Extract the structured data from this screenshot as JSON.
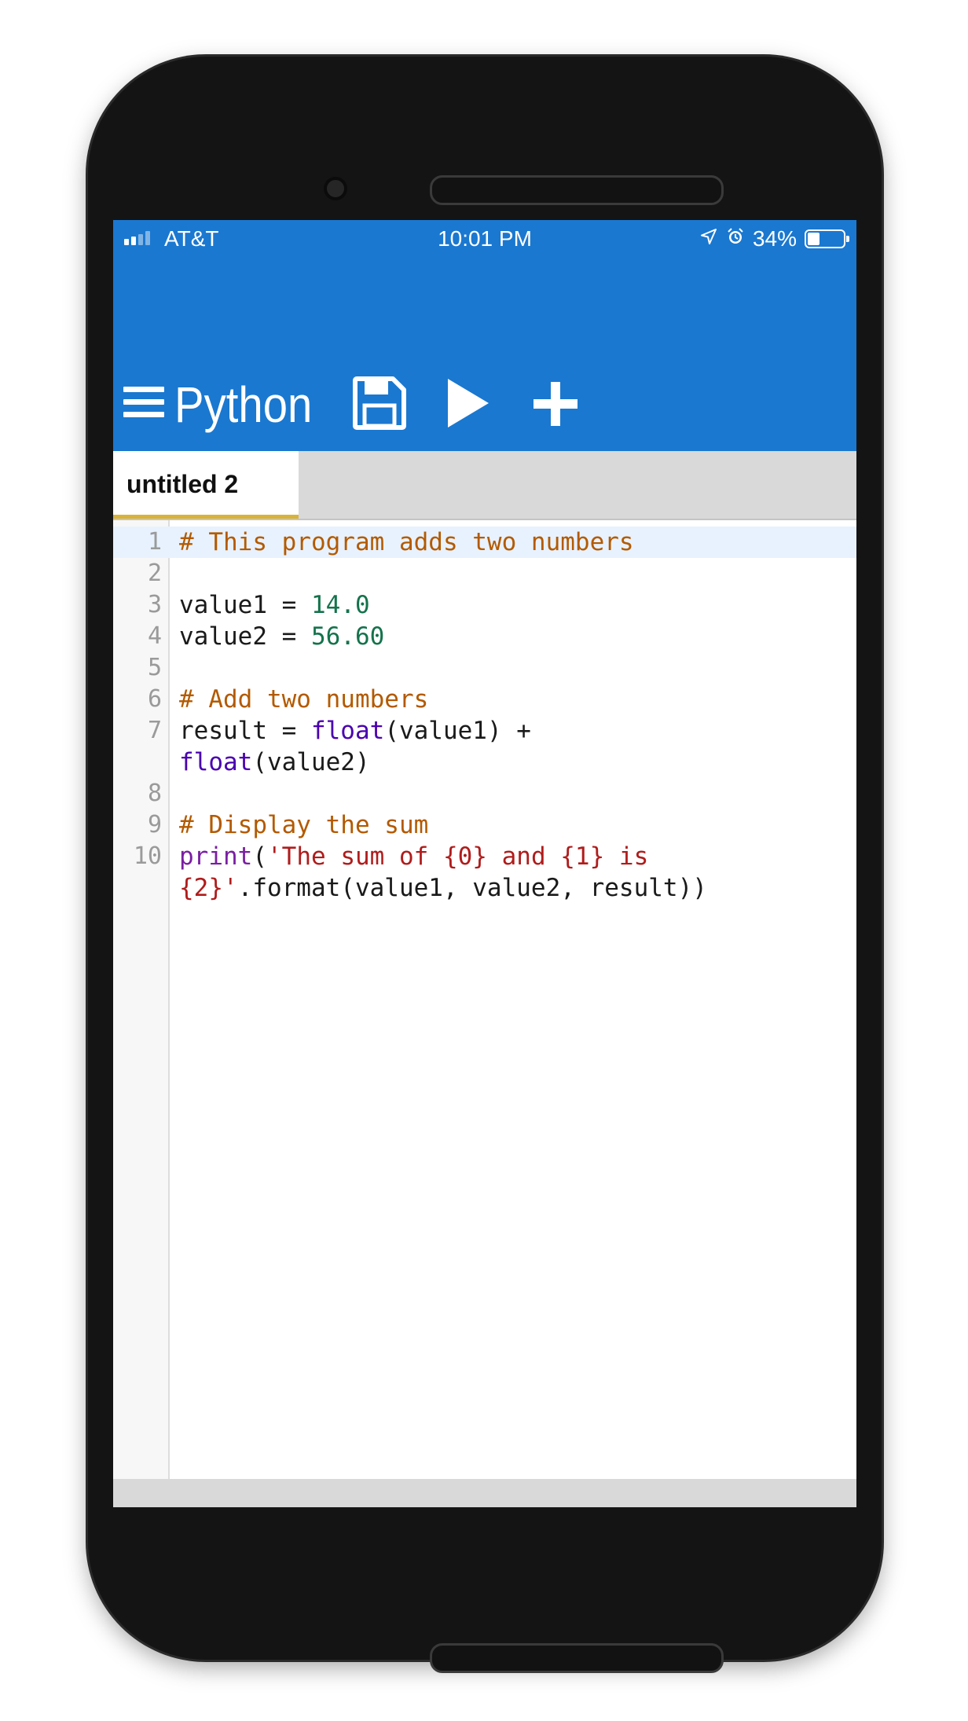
{
  "status_bar": {
    "carrier": "AT&T",
    "time": "10:01 PM",
    "battery": "34%",
    "battery_level": 0.34
  },
  "header": {
    "title": "Python",
    "menu_icon": "hamburger-menu-icon",
    "save_icon": "save-icon",
    "run_icon": "play-icon",
    "new_icon": "plus-icon",
    "accent_color": "#1a78d0"
  },
  "tabs": [
    {
      "label": "untitled 2",
      "active": true
    }
  ],
  "editor": {
    "lines": [
      {
        "number": "1",
        "tokens": [
          {
            "text": "# This program adds two numbers",
            "type": "comment"
          }
        ]
      },
      {
        "number": "2",
        "tokens": []
      },
      {
        "number": "3",
        "tokens": [
          {
            "text": "value1 = ",
            "type": "plain"
          },
          {
            "text": "14.0",
            "type": "number"
          }
        ]
      },
      {
        "number": "4",
        "tokens": [
          {
            "text": "value2 = ",
            "type": "plain"
          },
          {
            "text": "56.60",
            "type": "number"
          }
        ]
      },
      {
        "number": "5",
        "tokens": []
      },
      {
        "number": "6",
        "tokens": [
          {
            "text": "# Add two numbers",
            "type": "comment"
          }
        ]
      },
      {
        "number": "7",
        "tokens": [
          {
            "text": "result = ",
            "type": "plain"
          },
          {
            "text": "float",
            "type": "builtin"
          },
          {
            "text": "(value1) +\n",
            "type": "plain"
          },
          {
            "text": "float",
            "type": "builtin"
          },
          {
            "text": "(value2)",
            "type": "plain"
          }
        ]
      },
      {
        "number": "8",
        "tokens": []
      },
      {
        "number": "9",
        "tokens": [
          {
            "text": "# Display the sum",
            "type": "comment"
          }
        ]
      },
      {
        "number": "10",
        "tokens": [
          {
            "text": "print",
            "type": "keyword"
          },
          {
            "text": "(",
            "type": "plain"
          },
          {
            "text": "'The sum of {0} and {1} is\n{2}'",
            "type": "string"
          },
          {
            "text": ".format(value1, value2, result))",
            "type": "plain"
          }
        ]
      }
    ],
    "active_line": 1
  }
}
